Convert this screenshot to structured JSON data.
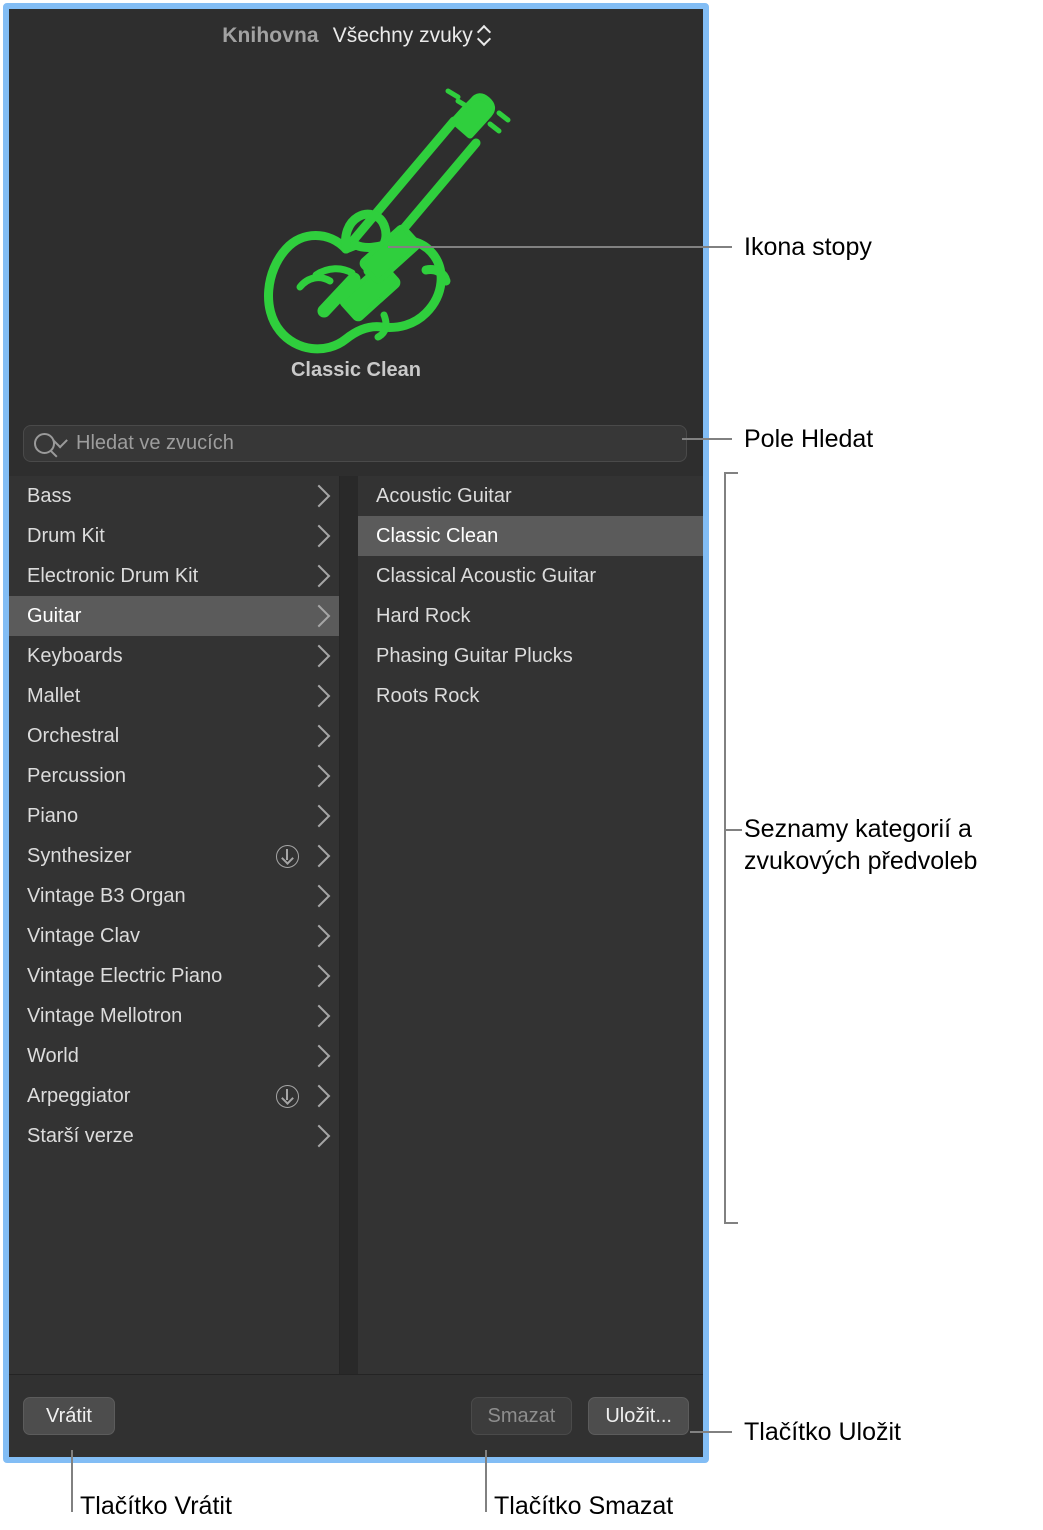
{
  "window": {
    "accent_focus_color": "#82bdf5",
    "panel_bg": "#2e2e2e",
    "icon_color": "#2fcf3d"
  },
  "header": {
    "title": "Knihovna",
    "popup_value": "Všechny zvuky",
    "popup_icon": "stepper-updown-icon"
  },
  "preview": {
    "icon_name": "electric-guitar-icon",
    "patch_name": "Classic Clean"
  },
  "search": {
    "icon": "search-icon",
    "chevron_icon": "chevron-down-icon",
    "value": "",
    "placeholder": "Hledat ve zvucích"
  },
  "browser": {
    "categories": [
      {
        "label": "Bass",
        "selected": false,
        "download": false
      },
      {
        "label": "Drum Kit",
        "selected": false,
        "download": false
      },
      {
        "label": "Electronic Drum Kit",
        "selected": false,
        "download": false
      },
      {
        "label": "Guitar",
        "selected": true,
        "download": false
      },
      {
        "label": "Keyboards",
        "selected": false,
        "download": false
      },
      {
        "label": "Mallet",
        "selected": false,
        "download": false
      },
      {
        "label": "Orchestral",
        "selected": false,
        "download": false
      },
      {
        "label": "Percussion",
        "selected": false,
        "download": false
      },
      {
        "label": "Piano",
        "selected": false,
        "download": false
      },
      {
        "label": "Synthesizer",
        "selected": false,
        "download": true
      },
      {
        "label": "Vintage B3 Organ",
        "selected": false,
        "download": false
      },
      {
        "label": "Vintage Clav",
        "selected": false,
        "download": false
      },
      {
        "label": "Vintage Electric Piano",
        "selected": false,
        "download": false
      },
      {
        "label": "Vintage Mellotron",
        "selected": false,
        "download": false
      },
      {
        "label": "World",
        "selected": false,
        "download": false
      },
      {
        "label": "Arpeggiator",
        "selected": false,
        "download": true
      },
      {
        "label": "Starší verze",
        "selected": false,
        "download": false
      }
    ],
    "presets": [
      {
        "label": "Acoustic Guitar",
        "selected": false
      },
      {
        "label": "Classic Clean",
        "selected": true
      },
      {
        "label": "Classical Acoustic Guitar",
        "selected": false
      },
      {
        "label": "Hard Rock",
        "selected": false
      },
      {
        "label": "Phasing Guitar Plucks",
        "selected": false
      },
      {
        "label": "Roots Rock",
        "selected": false
      }
    ]
  },
  "footer": {
    "revert_label": "Vrátit",
    "delete_label": "Smazat",
    "delete_disabled": true,
    "save_label": "Uložit..."
  },
  "callouts": {
    "track_icon": "Ikona stopy",
    "search_field": "Pole Hledat",
    "lists": "Seznamy kategorií a\nzvukových předvoleb",
    "save_button": "Tlačítko Uložit",
    "revert_button": "Tlačítko Vrátit",
    "delete_button": "Tlačítko Smazat"
  }
}
